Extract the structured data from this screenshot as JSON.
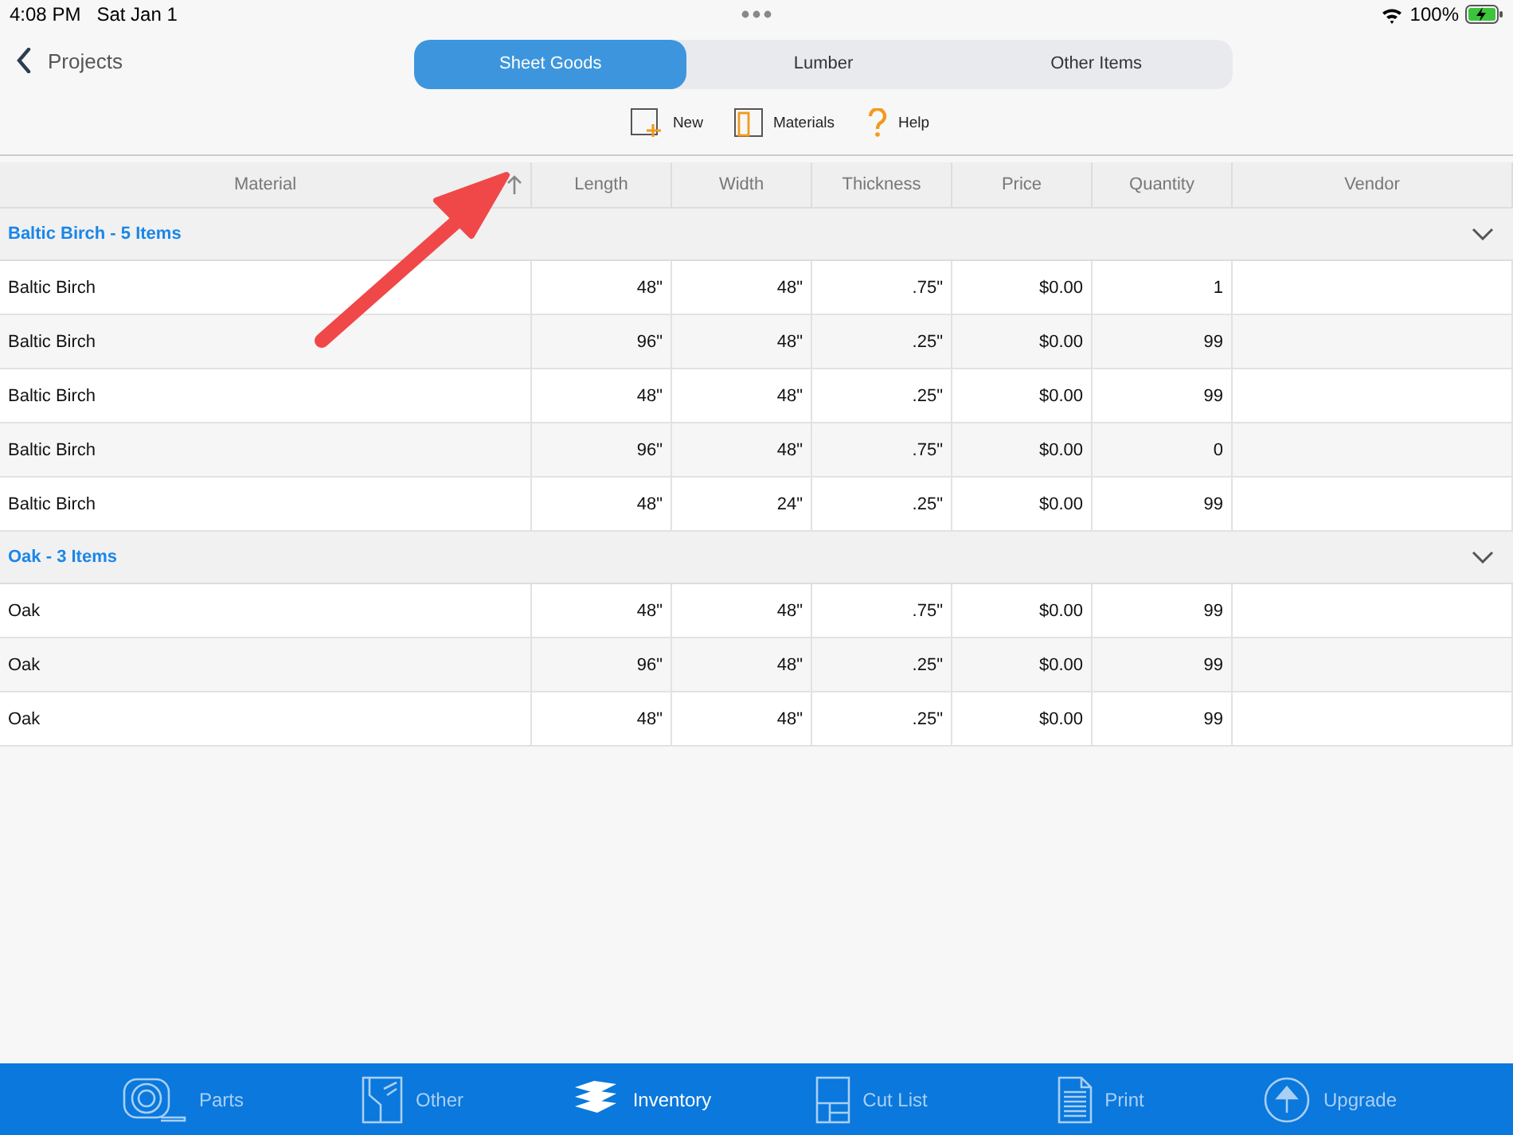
{
  "status_bar": {
    "time": "4:08 PM",
    "date": "Sat Jan 1",
    "battery": "100%"
  },
  "nav": {
    "back": "Projects"
  },
  "tabs": [
    {
      "label": "Sheet Goods",
      "selected": true
    },
    {
      "label": "Lumber",
      "selected": false
    },
    {
      "label": "Other Items",
      "selected": false
    }
  ],
  "toolbar": [
    {
      "label": "New"
    },
    {
      "label": "Materials"
    },
    {
      "label": "Help"
    }
  ],
  "table": {
    "columns": [
      {
        "label": "Material",
        "sorted": true
      },
      {
        "label": "Length",
        "sorted": false
      },
      {
        "label": "Width",
        "sorted": false
      },
      {
        "label": "Thickness",
        "sorted": false
      },
      {
        "label": "Price",
        "sorted": false
      },
      {
        "label": "Quantity",
        "sorted": false
      },
      {
        "label": "Vendor",
        "sorted": false
      }
    ],
    "groups": [
      {
        "title": "Baltic Birch - 5 Items",
        "expanded": true,
        "rows": [
          [
            "Baltic Birch",
            "48\"",
            "48\"",
            ".75\"",
            "$0.00",
            "1"
          ],
          [
            "Baltic Birch",
            "96\"",
            "48\"",
            ".25\"",
            "$0.00",
            "99"
          ],
          [
            "Baltic Birch",
            "48\"",
            "48\"",
            ".25\"",
            "$0.00",
            "99"
          ],
          [
            "Baltic Birch",
            "96\"",
            "48\"",
            ".75\"",
            "$0.00",
            "0"
          ],
          [
            "Baltic Birch",
            "48\"",
            "24\"",
            ".25\"",
            "$0.00",
            "99"
          ]
        ]
      },
      {
        "title": "Oak - 3 Items",
        "expanded": true,
        "rows": [
          [
            "Oak",
            "48\"",
            "48\"",
            ".75\"",
            "$0.00",
            "99"
          ],
          [
            "Oak",
            "96\"",
            "48\"",
            ".25\"",
            "$0.00",
            "99"
          ],
          [
            "Oak",
            "48\"",
            "48\"",
            ".25\"",
            "$0.00",
            "99"
          ]
        ]
      }
    ]
  },
  "tab_bar": [
    {
      "label": "Parts",
      "selected": false
    },
    {
      "label": "Other",
      "selected": false
    },
    {
      "label": "Inventory",
      "selected": true
    },
    {
      "label": "Cut List",
      "selected": false
    },
    {
      "label": "Print",
      "selected": false
    },
    {
      "label": "Upgrade",
      "selected": false
    }
  ]
}
